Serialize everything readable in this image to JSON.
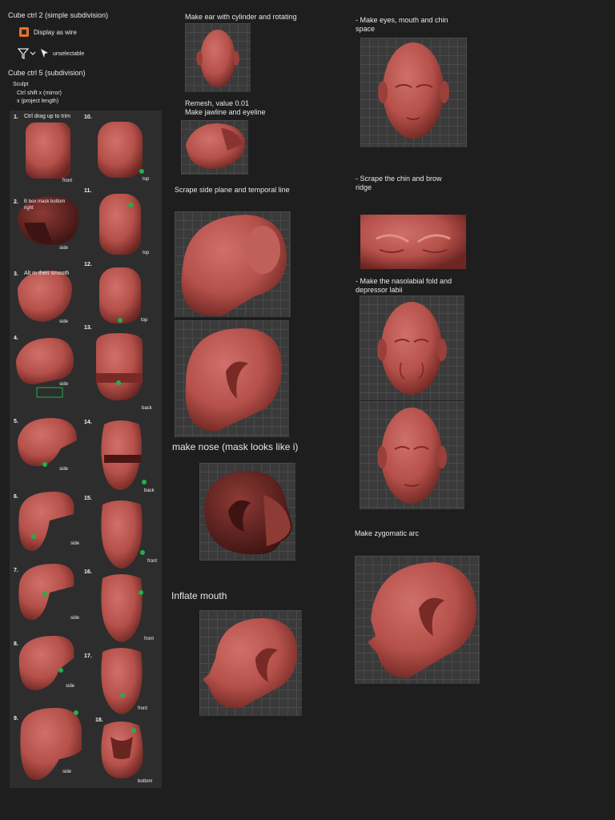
{
  "header": {
    "cube2": "Cube ctrl 2 (simple subdivision)",
    "display_wire": "Display as wire",
    "unselectable": "unselectable",
    "cube5": "Cube ctrl 5 (subdivision)",
    "sculpt": "Sculpt",
    "ctrl_shift_x": "Ctrl shift x (mirror)",
    "x_project": "x (project length)"
  },
  "steps": [
    {
      "num": "1.",
      "note": "Ctrl drag up to trim",
      "view": "front"
    },
    {
      "num": "2.",
      "note": "B box mask bottom\nright",
      "view": "side"
    },
    {
      "num": "3.",
      "note": "Alt m then smooth",
      "view": "side"
    },
    {
      "num": "4.",
      "note": "",
      "view": "side"
    },
    {
      "num": "5.",
      "note": "",
      "view": "side"
    },
    {
      "num": "6.",
      "note": "",
      "view": "side"
    },
    {
      "num": "7.",
      "note": "",
      "view": "side"
    },
    {
      "num": "8.",
      "note": "",
      "view": "side"
    },
    {
      "num": "9.",
      "note": "",
      "view": "side"
    },
    {
      "num": "10.",
      "note": "",
      "view": "top"
    },
    {
      "num": "11.",
      "note": "",
      "view": "top"
    },
    {
      "num": "12.",
      "note": "",
      "view": "top"
    },
    {
      "num": "13.",
      "note": "",
      "view": "back"
    },
    {
      "num": "14.",
      "note": "",
      "view": "back"
    },
    {
      "num": "15.",
      "note": "",
      "view": "front"
    },
    {
      "num": "16.",
      "note": "",
      "view": "front"
    },
    {
      "num": "17.",
      "note": "",
      "view": "front"
    },
    {
      "num": "18.",
      "note": "",
      "view": "bottom"
    }
  ],
  "mid": {
    "ear": "Make ear with cylinder and rotating",
    "remesh": "Remesh, value 0.01\nMake jawline and eyeline",
    "scrape_side": "Scrape side plane and temporal line",
    "nose": "make nose (mask looks like i)",
    "inflate": "Inflate mouth"
  },
  "right": {
    "eyes": "-   Make eyes, mouth and chin\n     space",
    "scrape_chin": "-   Scrape the chin and brow\n     ridge",
    "nasolabial": "-   Make the nasolabial fold and\n     depressor labii",
    "zygomatic": "Make zygomatic arc"
  },
  "colors": {
    "background": "#1e1e1e",
    "clay": "#b5504a",
    "viewport": "#3a3a3a",
    "marker": "#22b04a",
    "wire_icon": "#e8742a"
  }
}
